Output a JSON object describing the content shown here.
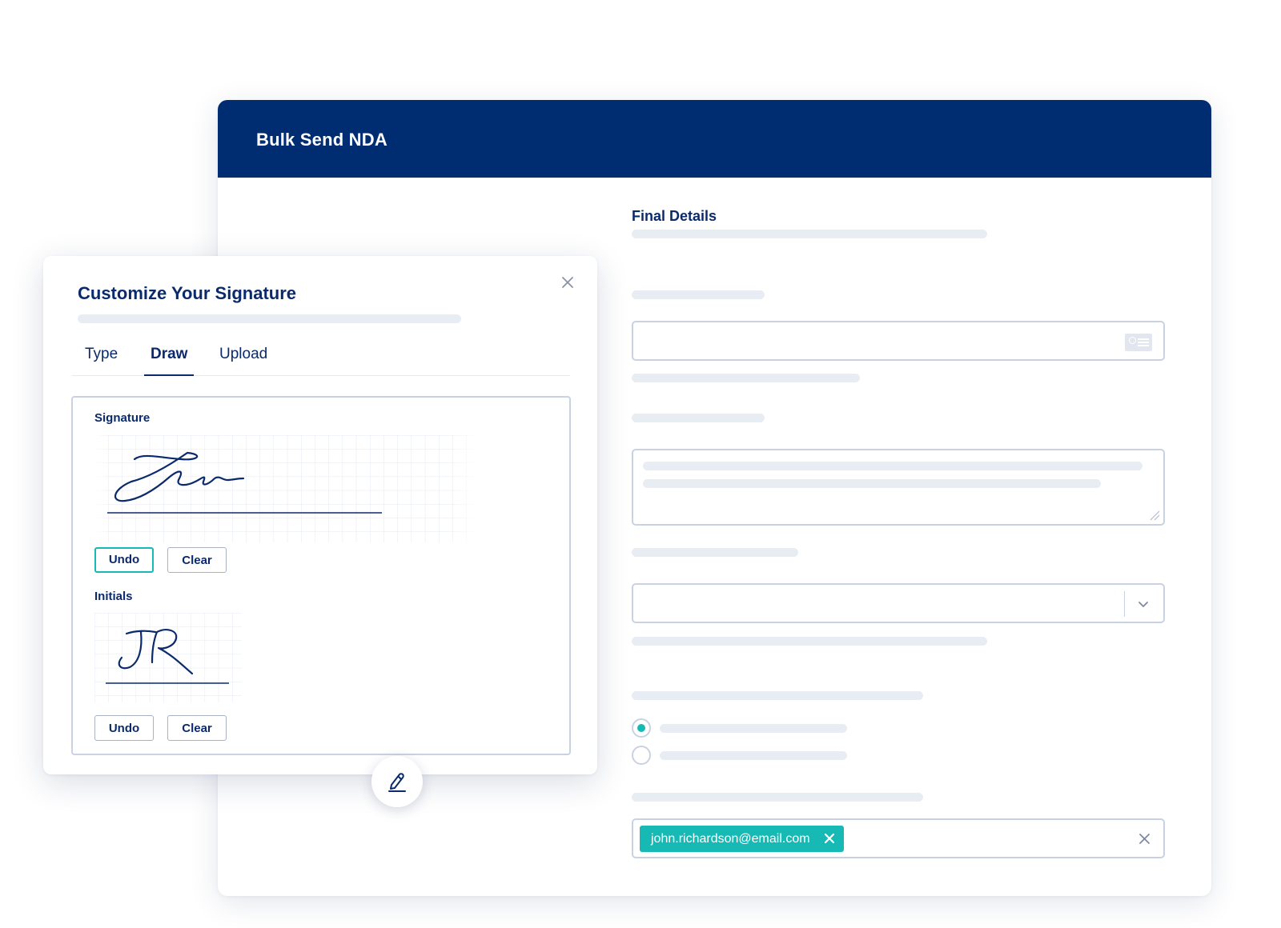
{
  "main_window": {
    "title": "Bulk Send NDA",
    "section_title": "Final Details",
    "recipient_email_chip": "john.richardson@email.com",
    "radio_options": [
      {
        "checked": true
      },
      {
        "checked": false
      }
    ],
    "icons": {
      "contact": "contact-card-icon",
      "dropdown": "chevron-down-icon",
      "chip_remove": "close-icon",
      "clear": "close-icon",
      "resize": "resize-grip-icon"
    }
  },
  "signature_modal": {
    "title": "Customize Your Signature",
    "tabs": [
      {
        "label": "Type",
        "active": false
      },
      {
        "label": "Draw",
        "active": true
      },
      {
        "label": "Upload",
        "active": false
      }
    ],
    "signature_label": "Signature",
    "initials_label": "Initials",
    "signature_buttons": {
      "undo": "Undo",
      "clear": "Clear"
    },
    "initials_buttons": {
      "undo": "Undo",
      "clear": "Clear"
    },
    "icons": {
      "close": "close-icon",
      "edit": "pencil-icon"
    }
  },
  "colors": {
    "header_bg": "#002d72",
    "brand_text": "#0b2a6b",
    "accent_teal": "#16b9b3",
    "placeholder": "#e8ecf3",
    "field_border": "#c9d2e2"
  }
}
